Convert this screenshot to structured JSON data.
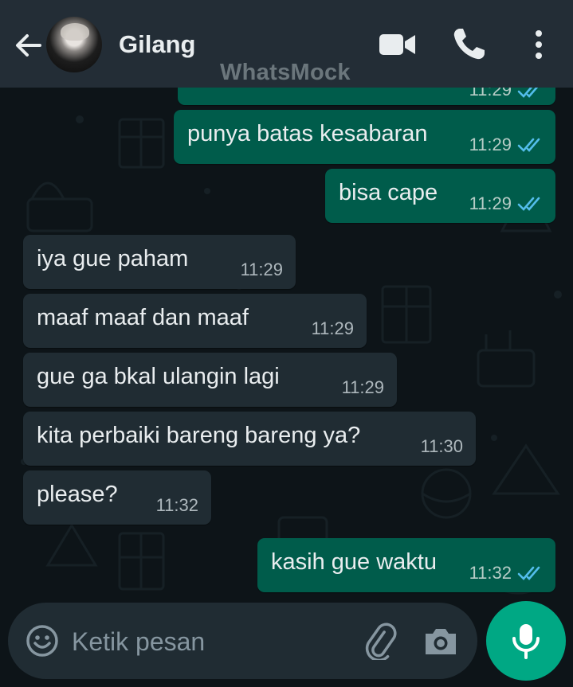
{
  "header": {
    "contact_name": "Gilang",
    "watermark": "WhatsMock",
    "icons": [
      "back-arrow-icon",
      "avatar",
      "video-call-icon",
      "phone-icon",
      "more-vert-icon"
    ]
  },
  "messages": [
    {
      "direction": "out",
      "text": "",
      "time": "11:29",
      "status": "read"
    },
    {
      "direction": "out",
      "text": "punya batas kesabaran",
      "time": "11:29",
      "status": "read"
    },
    {
      "direction": "out",
      "text": "bisa cape",
      "time": "11:29",
      "status": "read"
    },
    {
      "direction": "in",
      "text": "iya gue paham",
      "time": "11:29"
    },
    {
      "direction": "in",
      "text": "maaf maaf dan maaf",
      "time": "11:29"
    },
    {
      "direction": "in",
      "text": "gue ga bkal ulangin lagi",
      "time": "11:29"
    },
    {
      "direction": "in",
      "text": "kita perbaiki bareng bareng ya?",
      "time": "11:30"
    },
    {
      "direction": "in",
      "text": "please?",
      "time": "11:32"
    },
    {
      "direction": "out",
      "text": "kasih gue waktu",
      "time": "11:32",
      "status": "read"
    }
  ],
  "composer": {
    "placeholder": "Ketik pesan",
    "value": "",
    "icons": [
      "emoji-icon",
      "attach-icon",
      "camera-icon",
      "mic-icon"
    ]
  },
  "colors": {
    "header_bg": "#232d36",
    "chat_bg": "#0d1418",
    "outgoing_bubble": "#005c4b",
    "incoming_bubble": "#202c33",
    "read_tick": "#53bdeb",
    "accent": "#00a884"
  }
}
